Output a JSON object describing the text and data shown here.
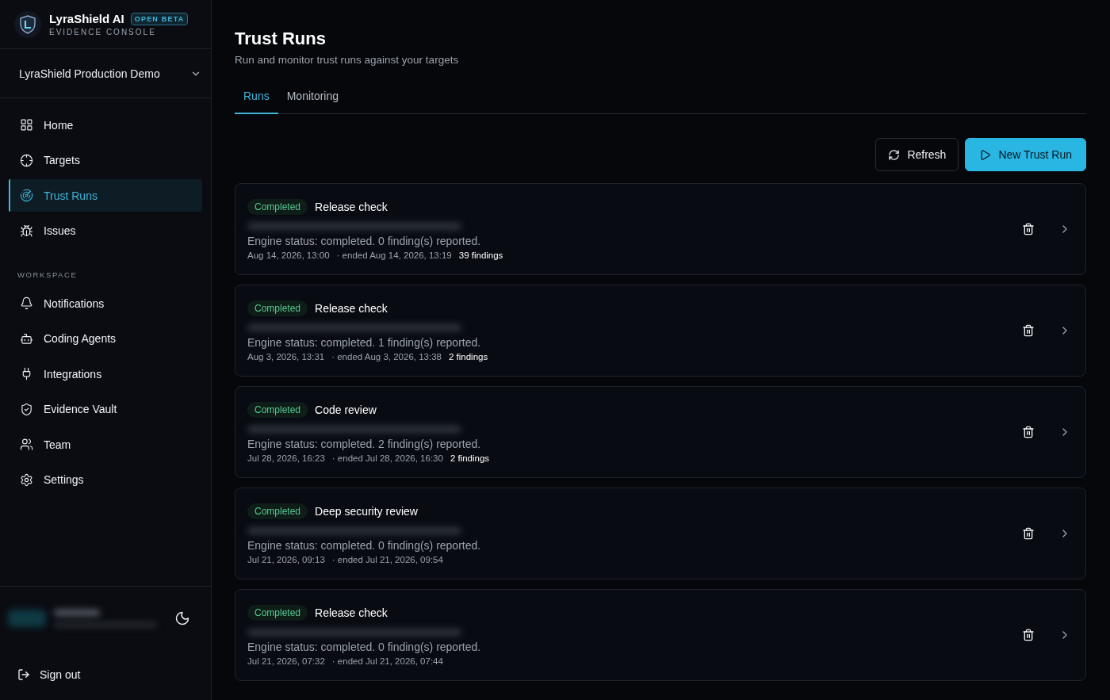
{
  "brand": {
    "name": "LyraShield AI",
    "badge": "OPEN BETA",
    "subtitle": "EVIDENCE CONSOLE"
  },
  "workspace_picker": {
    "value": "LyraShield Production Demo"
  },
  "nav": [
    {
      "label": "Home",
      "selected": false
    },
    {
      "label": "Targets",
      "selected": false
    },
    {
      "label": "Trust Runs",
      "selected": true
    },
    {
      "label": "Issues",
      "selected": false
    }
  ],
  "workspace_section": {
    "heading": "WORKSPACE",
    "items": [
      {
        "label": "Notifications",
        "selected": false
      },
      {
        "label": "Coding Agents",
        "selected": false
      },
      {
        "label": "Integrations",
        "selected": false
      },
      {
        "label": "Evidence Vault",
        "selected": false
      },
      {
        "label": "Team",
        "selected": false
      },
      {
        "label": "Settings",
        "selected": false
      }
    ]
  },
  "sign_out": "Sign out",
  "page": {
    "title": "Trust Runs",
    "subtitle": "Run and monitor trust runs against your targets"
  },
  "tabs": [
    {
      "label": "Runs",
      "selected": true
    },
    {
      "label": "Monitoring",
      "selected": false
    }
  ],
  "actions": {
    "refresh": "Refresh",
    "new_run": "New Trust Run"
  },
  "runs": [
    {
      "status": "Completed",
      "name": "Release check",
      "engine": "Engine status: completed. 0 finding(s) reported.",
      "started": "Aug 14, 2026, 13:00",
      "ended": "· ended Aug 14, 2026, 13:19",
      "findings": "39 findings"
    },
    {
      "status": "Completed",
      "name": "Release check",
      "engine": "Engine status: completed. 1 finding(s) reported.",
      "started": "Aug 3, 2026, 13:31",
      "ended": "· ended Aug 3, 2026, 13:38",
      "findings": "2 findings"
    },
    {
      "status": "Completed",
      "name": "Code review",
      "engine": "Engine status: completed. 2 finding(s) reported.",
      "started": "Jul 28, 2026, 16:23",
      "ended": "· ended Jul 28, 2026, 16:30",
      "findings": "2 findings"
    },
    {
      "status": "Completed",
      "name": "Deep security review",
      "engine": "Engine status: completed. 0 finding(s) reported.",
      "started": "Jul 21, 2026, 09:13",
      "ended": "· ended Jul 21, 2026, 09:54"
    },
    {
      "status": "Completed",
      "name": "Release check",
      "engine": "Engine status: completed. 0 finding(s) reported.",
      "started": "Jul 21, 2026, 07:32",
      "ended": "· ended Jul 21, 2026, 07:44"
    }
  ]
}
